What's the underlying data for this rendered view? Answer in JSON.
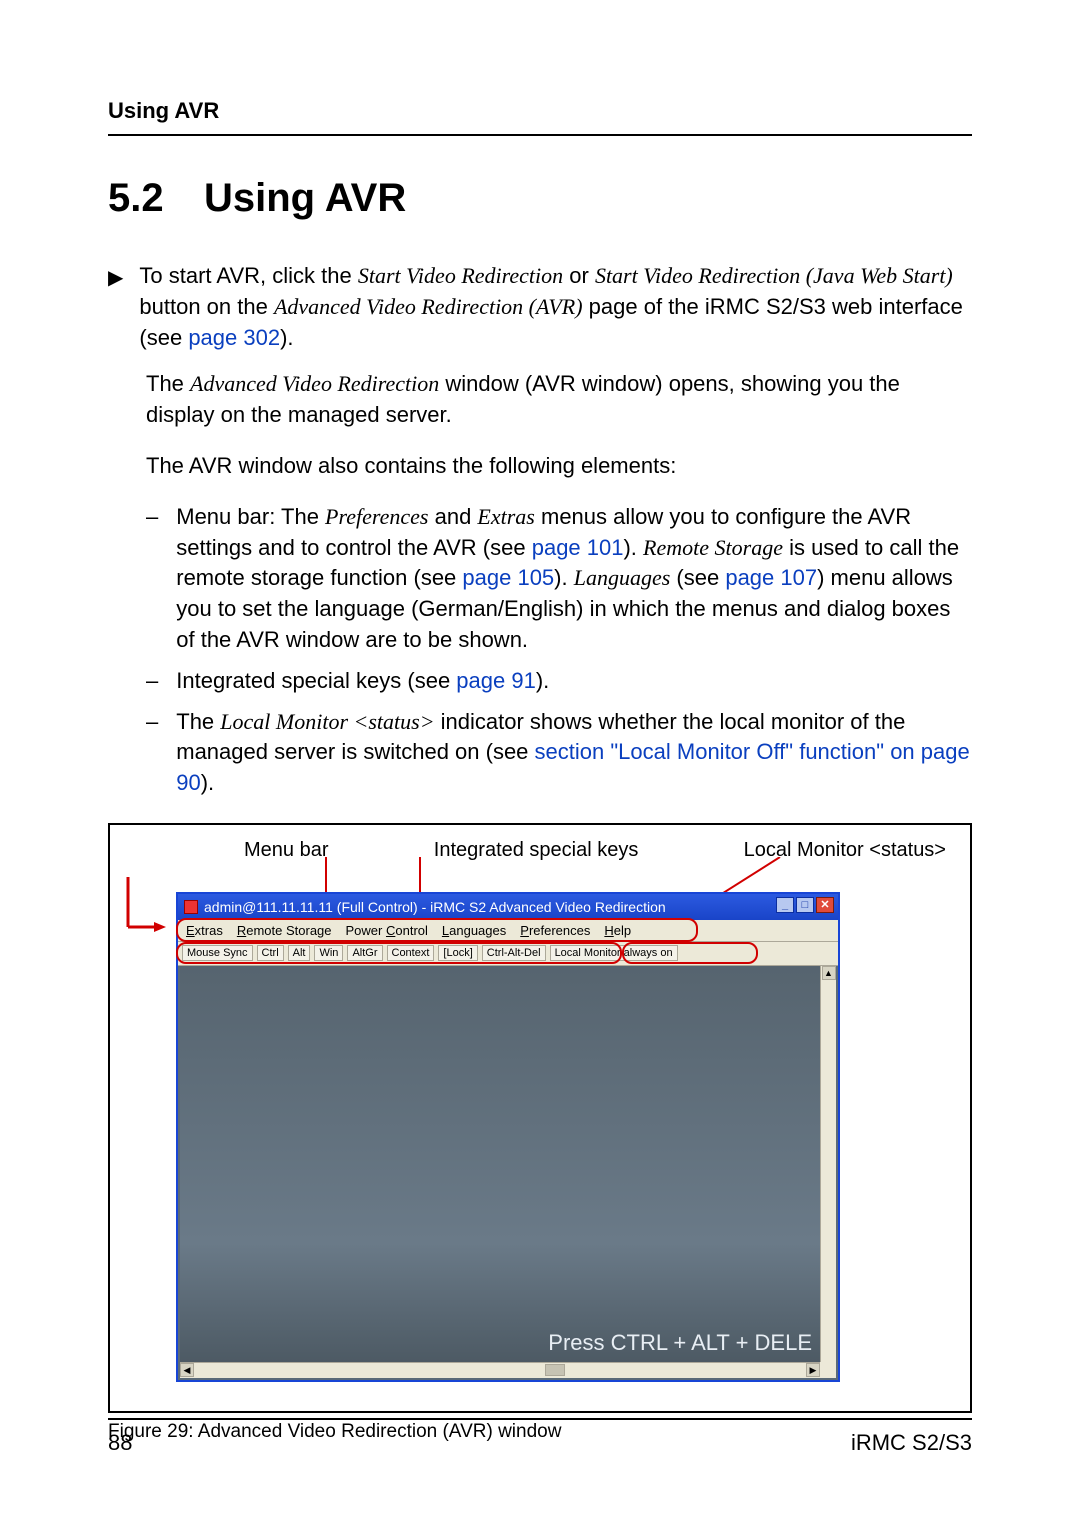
{
  "header": {
    "running": "Using AVR"
  },
  "section": {
    "number": "5.2",
    "title": "Using AVR"
  },
  "para1": {
    "pre": "To start AVR, click the ",
    "link1_italic": "Start Video Redirection",
    "mid1": " or ",
    "link2_italic": "Start Video Redirection (Java Web Start)",
    "mid2": " button on the ",
    "em1": "Advanced Video Redirection (AVR)",
    "post": " page of the iRMC S2/S3 web interface (see ",
    "pagelink": "page 302",
    "end": ")."
  },
  "para2": {
    "pre": "The ",
    "em": "Advanced Video Redirection",
    "post": " window (AVR window) opens, showing you the display on the managed server."
  },
  "para3": "The AVR window also contains the following elements:",
  "items": {
    "menubar": {
      "a": "Menu bar: The ",
      "em1": "Preferences",
      "b": " and ",
      "em2": "Extras",
      "c": " menus allow you to configure the AVR settings and to control the AVR (see ",
      "link1": "page 101",
      "d": "). ",
      "em3": "Remote Storage",
      "e": " is used to call the remote storage function (see ",
      "link2": "page 105",
      "f": "). ",
      "em4": "Languages",
      "g": " (see ",
      "link3": "page 107",
      "h": ") menu allows you to set the language (German/English) in which the menus and dialog boxes of the AVR window are to be shown."
    },
    "keys": {
      "a": "Integrated special keys (see ",
      "link": "page 91",
      "b": ")."
    },
    "localmon": {
      "a": "The ",
      "em": "Local Monitor <status>",
      "b": " indicator shows whether the local monitor of the managed server is switched on (see ",
      "link": "section \"Local Monitor Off\" function\" on page 90",
      "c": ")."
    }
  },
  "figure": {
    "labels": {
      "menubar": "Menu bar",
      "keys": "Integrated special keys",
      "localmon": "Local Monitor <status>"
    },
    "window": {
      "title": "admin@111.11.11.11 (Full Control) - iRMC S2 Advanced Video Redirection",
      "menus": [
        "Extras",
        "Remote Storage",
        "Power Control",
        "Languages",
        "Preferences",
        "Help"
      ],
      "toolbar": [
        "Mouse Sync",
        "Ctrl",
        "Alt",
        "Win",
        "AltGr",
        "Context",
        "[Lock]",
        "Ctrl-Alt-Del",
        "Local Monitor always on"
      ],
      "content_text": "Press CTRL + ALT + DELE"
    },
    "caption": "Figure 29:  Advanced Video Redirection (AVR) window"
  },
  "footer": {
    "page": "88",
    "doc": "iRMC S2/S3"
  }
}
